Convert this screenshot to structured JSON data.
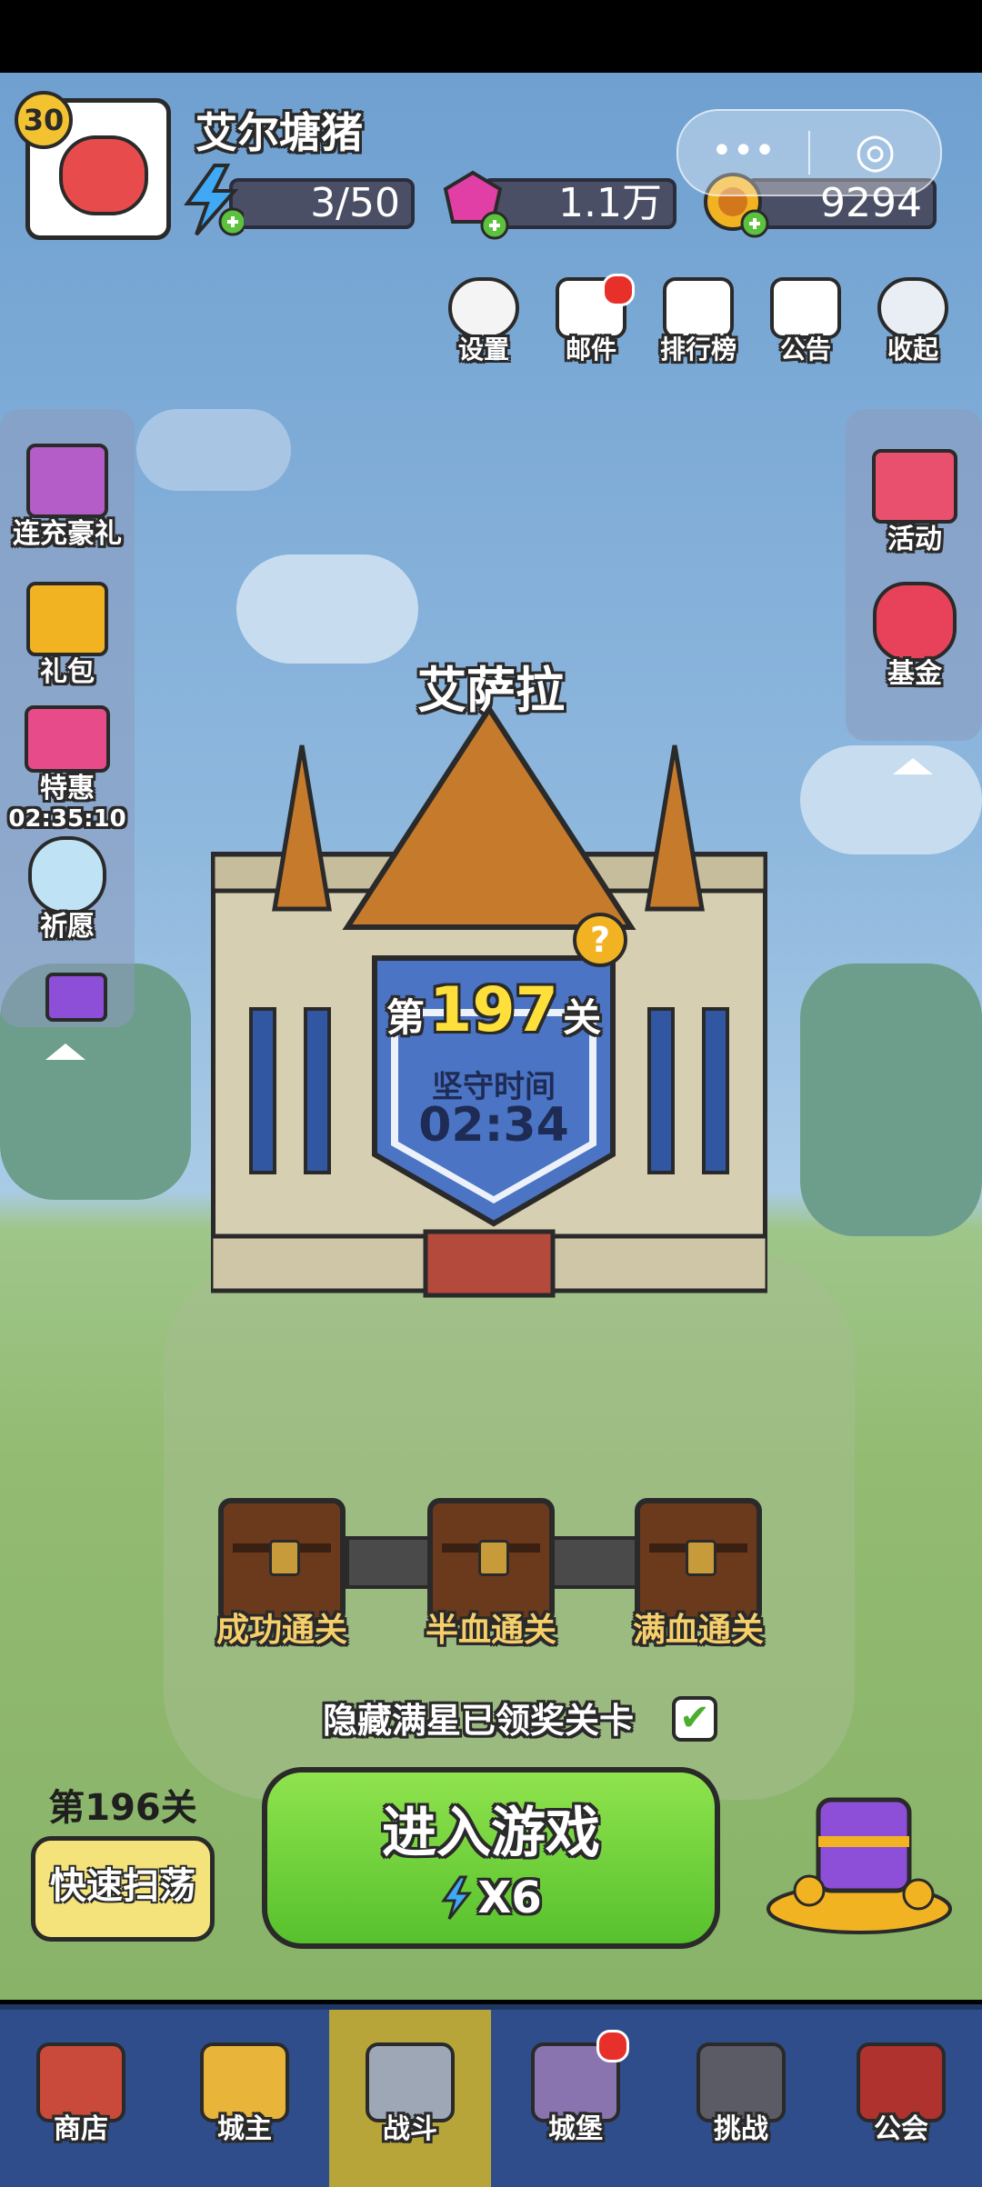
{
  "player": {
    "level": "30",
    "name": "艾尔塘猪"
  },
  "resources": {
    "energy": "3/50",
    "gems": "1.1万",
    "gold": "9294"
  },
  "capsule": {
    "more": "•••",
    "close": "◎"
  },
  "top_menu": [
    {
      "label": "设置",
      "icon": "gear-icon"
    },
    {
      "label": "邮件",
      "icon": "mail-icon"
    },
    {
      "label": "排行榜",
      "icon": "leaderboard-icon"
    },
    {
      "label": "公告",
      "icon": "megaphone-icon"
    },
    {
      "label": "收起",
      "icon": "collapse-icon"
    }
  ],
  "left_menu": [
    {
      "label": "连充豪礼",
      "icon": "gift-icon"
    },
    {
      "label": "礼包",
      "icon": "package-icon"
    },
    {
      "label": "特惠",
      "icon": "sale-icon",
      "timer": "02:35:10"
    },
    {
      "label": "祈愿",
      "icon": "wish-icon"
    }
  ],
  "right_menu": [
    {
      "label": "活动",
      "icon": "event-icon"
    },
    {
      "label": "基金",
      "icon": "fund-icon"
    }
  ],
  "stage": {
    "location": "艾萨拉",
    "prefix": "第",
    "number": "197",
    "suffix": "关",
    "hold_label": "坚守时间",
    "hold_time": "02:34",
    "help": "?"
  },
  "chests": [
    {
      "label": "成功通关"
    },
    {
      "label": "半血通关"
    },
    {
      "label": "满血通关"
    }
  ],
  "hide_toggle": {
    "label": "隐藏满星已领奖关卡",
    "checked": true
  },
  "sweep": {
    "stage": "第196关",
    "button": "快速扫荡"
  },
  "play": {
    "label": "进入游戏",
    "cost": "X6"
  },
  "nav": [
    {
      "label": "商店",
      "icon": "shop-icon",
      "color": "#c94a3a"
    },
    {
      "label": "城主",
      "icon": "crown-icon",
      "color": "#e8b53a"
    },
    {
      "label": "战斗",
      "icon": "swords-icon",
      "color": "#9ea7b5"
    },
    {
      "label": "城堡",
      "icon": "castle-icon",
      "color": "#8a74b0"
    },
    {
      "label": "挑战",
      "icon": "demon-icon",
      "color": "#5b5b66"
    },
    {
      "label": "公会",
      "icon": "guild-banner-icon",
      "color": "#b0322e"
    }
  ]
}
